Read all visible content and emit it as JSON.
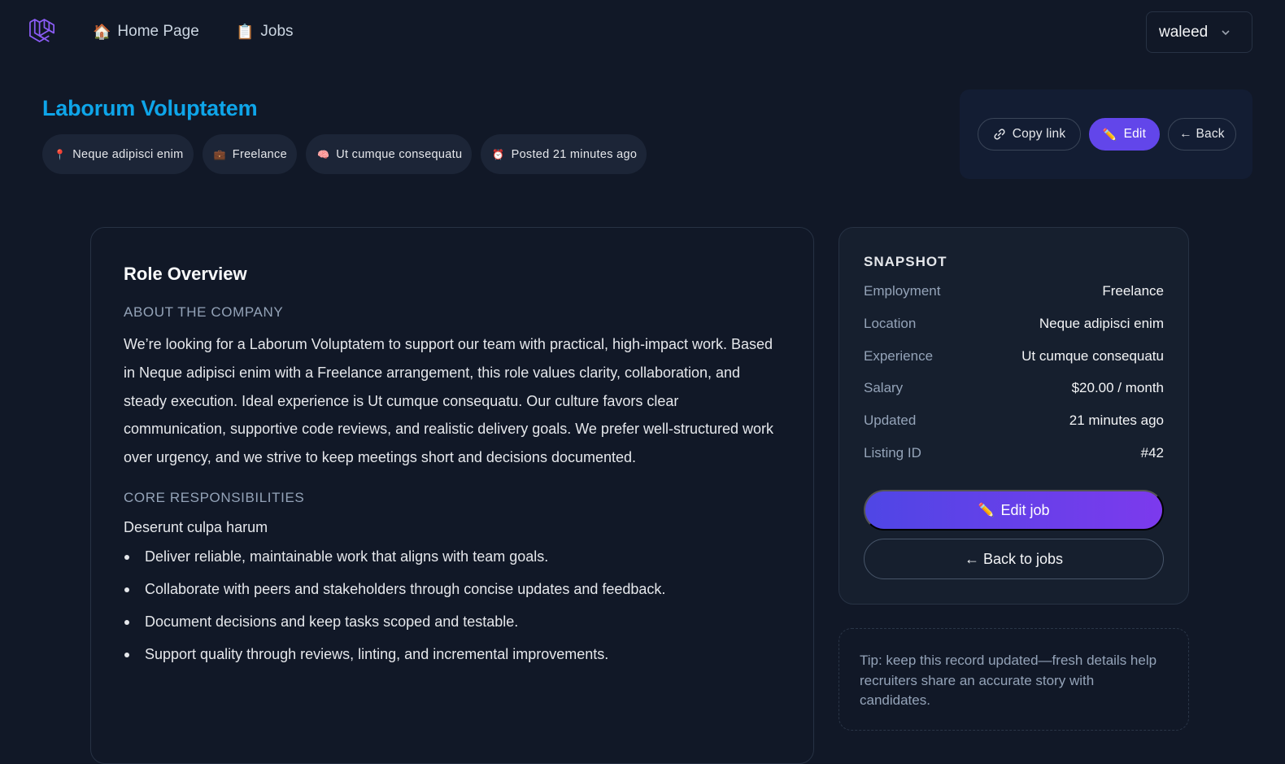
{
  "nav": {
    "home_icon": "🏠",
    "home_label": "Home Page",
    "jobs_icon": "📋",
    "jobs_label": "Jobs",
    "user_name": "waleed"
  },
  "header": {
    "title": "Laborum Voluptatem",
    "chips": [
      {
        "icon": "📍",
        "label": "Neque adipisci enim"
      },
      {
        "icon": "💼",
        "label": "Freelance"
      },
      {
        "icon": "🧠",
        "label": "Ut cumque consequatu"
      },
      {
        "icon": "⏰",
        "label": "Posted 21 minutes ago"
      }
    ],
    "actions": {
      "copy_link": "Copy link",
      "edit": "Edit",
      "back": "← Back"
    }
  },
  "main": {
    "heading": "Role Overview",
    "about_label": "ABOUT THE COMPANY",
    "about_text": "We’re looking for a Laborum Voluptatem to support our team with practical, high-impact work. Based in Neque adipisci enim with a Freelance arrangement, this role values clarity, collaboration, and steady execution. Ideal experience is Ut cumque consequatu. Our culture favors clear communication, supportive code reviews, and realistic delivery goals. We prefer well-structured work over urgency, and we strive to keep meetings short and decisions documented.",
    "responsibilities_label": "CORE RESPONSIBILITIES",
    "responsibilities_intro": "Deserunt culpa harum",
    "responsibilities": [
      "Deliver reliable, maintainable work that aligns with team goals.",
      "Collaborate with peers and stakeholders through concise updates and feedback.",
      "Document decisions and keep tasks scoped and testable.",
      "Support quality through reviews, linting, and incremental improvements."
    ]
  },
  "snapshot": {
    "title": "SNAPSHOT",
    "rows": [
      {
        "key": "Employment",
        "value": "Freelance"
      },
      {
        "key": "Location",
        "value": "Neque adipisci enim"
      },
      {
        "key": "Experience",
        "value": "Ut cumque consequatu"
      },
      {
        "key": "Salary",
        "value": "$20.00 / month"
      },
      {
        "key": "Updated",
        "value": "21 minutes ago"
      },
      {
        "key": "Listing ID",
        "value": "#42"
      }
    ],
    "edit_job": "Edit job",
    "back_to_jobs": "← Back to jobs"
  },
  "tip": "Tip: keep this record updated—fresh details help recruiters share an accurate story with candidates.",
  "colors": {
    "background": "#111827",
    "title_accent": "#0ea5e9",
    "primary": "#6246ea",
    "logo": "#8b5cf6"
  }
}
